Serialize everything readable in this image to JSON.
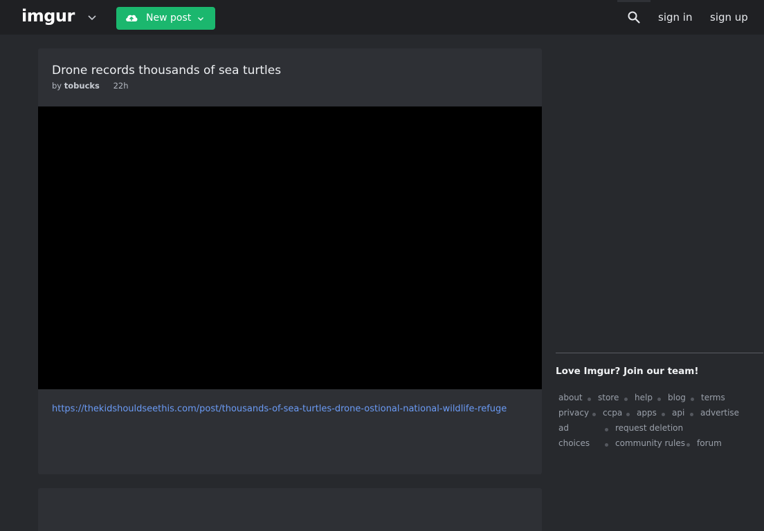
{
  "header": {
    "logo": "imgur",
    "new_post_label": "New post",
    "sign_in": "sign in",
    "sign_up": "sign up",
    "accent_color": "#1bb76e"
  },
  "post": {
    "title": "Drone records thousands of sea turtles",
    "by_label": "by",
    "author": "tobucks",
    "time": "22h",
    "link": "https://thekidshouldseethis.com/post/thousands-of-sea-turtles-drone-ostional-national-wildlife-refuge"
  },
  "sidebar": {
    "join_team": "Love Imgur? Join our team!",
    "footer_links": {
      "about": "about",
      "store": "store",
      "help": "help",
      "blog": "blog",
      "terms": "terms",
      "privacy": "privacy",
      "ccpa": "ccpa",
      "apps": "apps",
      "api": "api",
      "advertise": "advertise",
      "ad": "ad",
      "choices": "choices",
      "request_deletion": "request deletion",
      "community_rules": "community rules",
      "forum": "forum"
    }
  }
}
